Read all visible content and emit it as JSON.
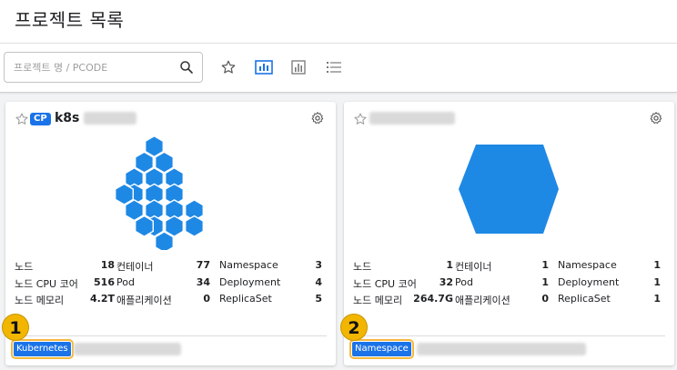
{
  "header": {
    "title": "프로젝트 목록"
  },
  "toolbar": {
    "search_placeholder": "프로젝트 명 / PCODE",
    "icons": [
      "search-icon",
      "star-outline-icon",
      "card-view-icon",
      "chart-view-icon",
      "list-view-icon"
    ],
    "active_view": "card-view-icon",
    "accent_color": "#1a73e8"
  },
  "cards": [
    {
      "badge": "CP",
      "name": "k8s",
      "tag": "Kubernetes",
      "hex_color": "#1e88e5",
      "stats": [
        [
          "노드",
          "18",
          "컨테이너",
          "77",
          "Namespace",
          "3"
        ],
        [
          "노드 CPU 코어",
          "516",
          "Pod",
          "34",
          "Deployment",
          "4"
        ],
        [
          "노드 메모리",
          "4.2T",
          "애플리케이션",
          "0",
          "ReplicaSet",
          "5"
        ]
      ],
      "marker": "1"
    },
    {
      "name": "",
      "tag": "Namespace",
      "hex_color": "#1e88e5",
      "stats": [
        [
          "노드",
          "1",
          "컨테이너",
          "1",
          "Namespace",
          "1"
        ],
        [
          "노드 CPU 코어",
          "32",
          "Pod",
          "1",
          "Deployment",
          "1"
        ],
        [
          "노드 메모리",
          "264.7G",
          "애플리케이션",
          "0",
          "ReplicaSet",
          "1"
        ]
      ],
      "marker": "2"
    }
  ]
}
